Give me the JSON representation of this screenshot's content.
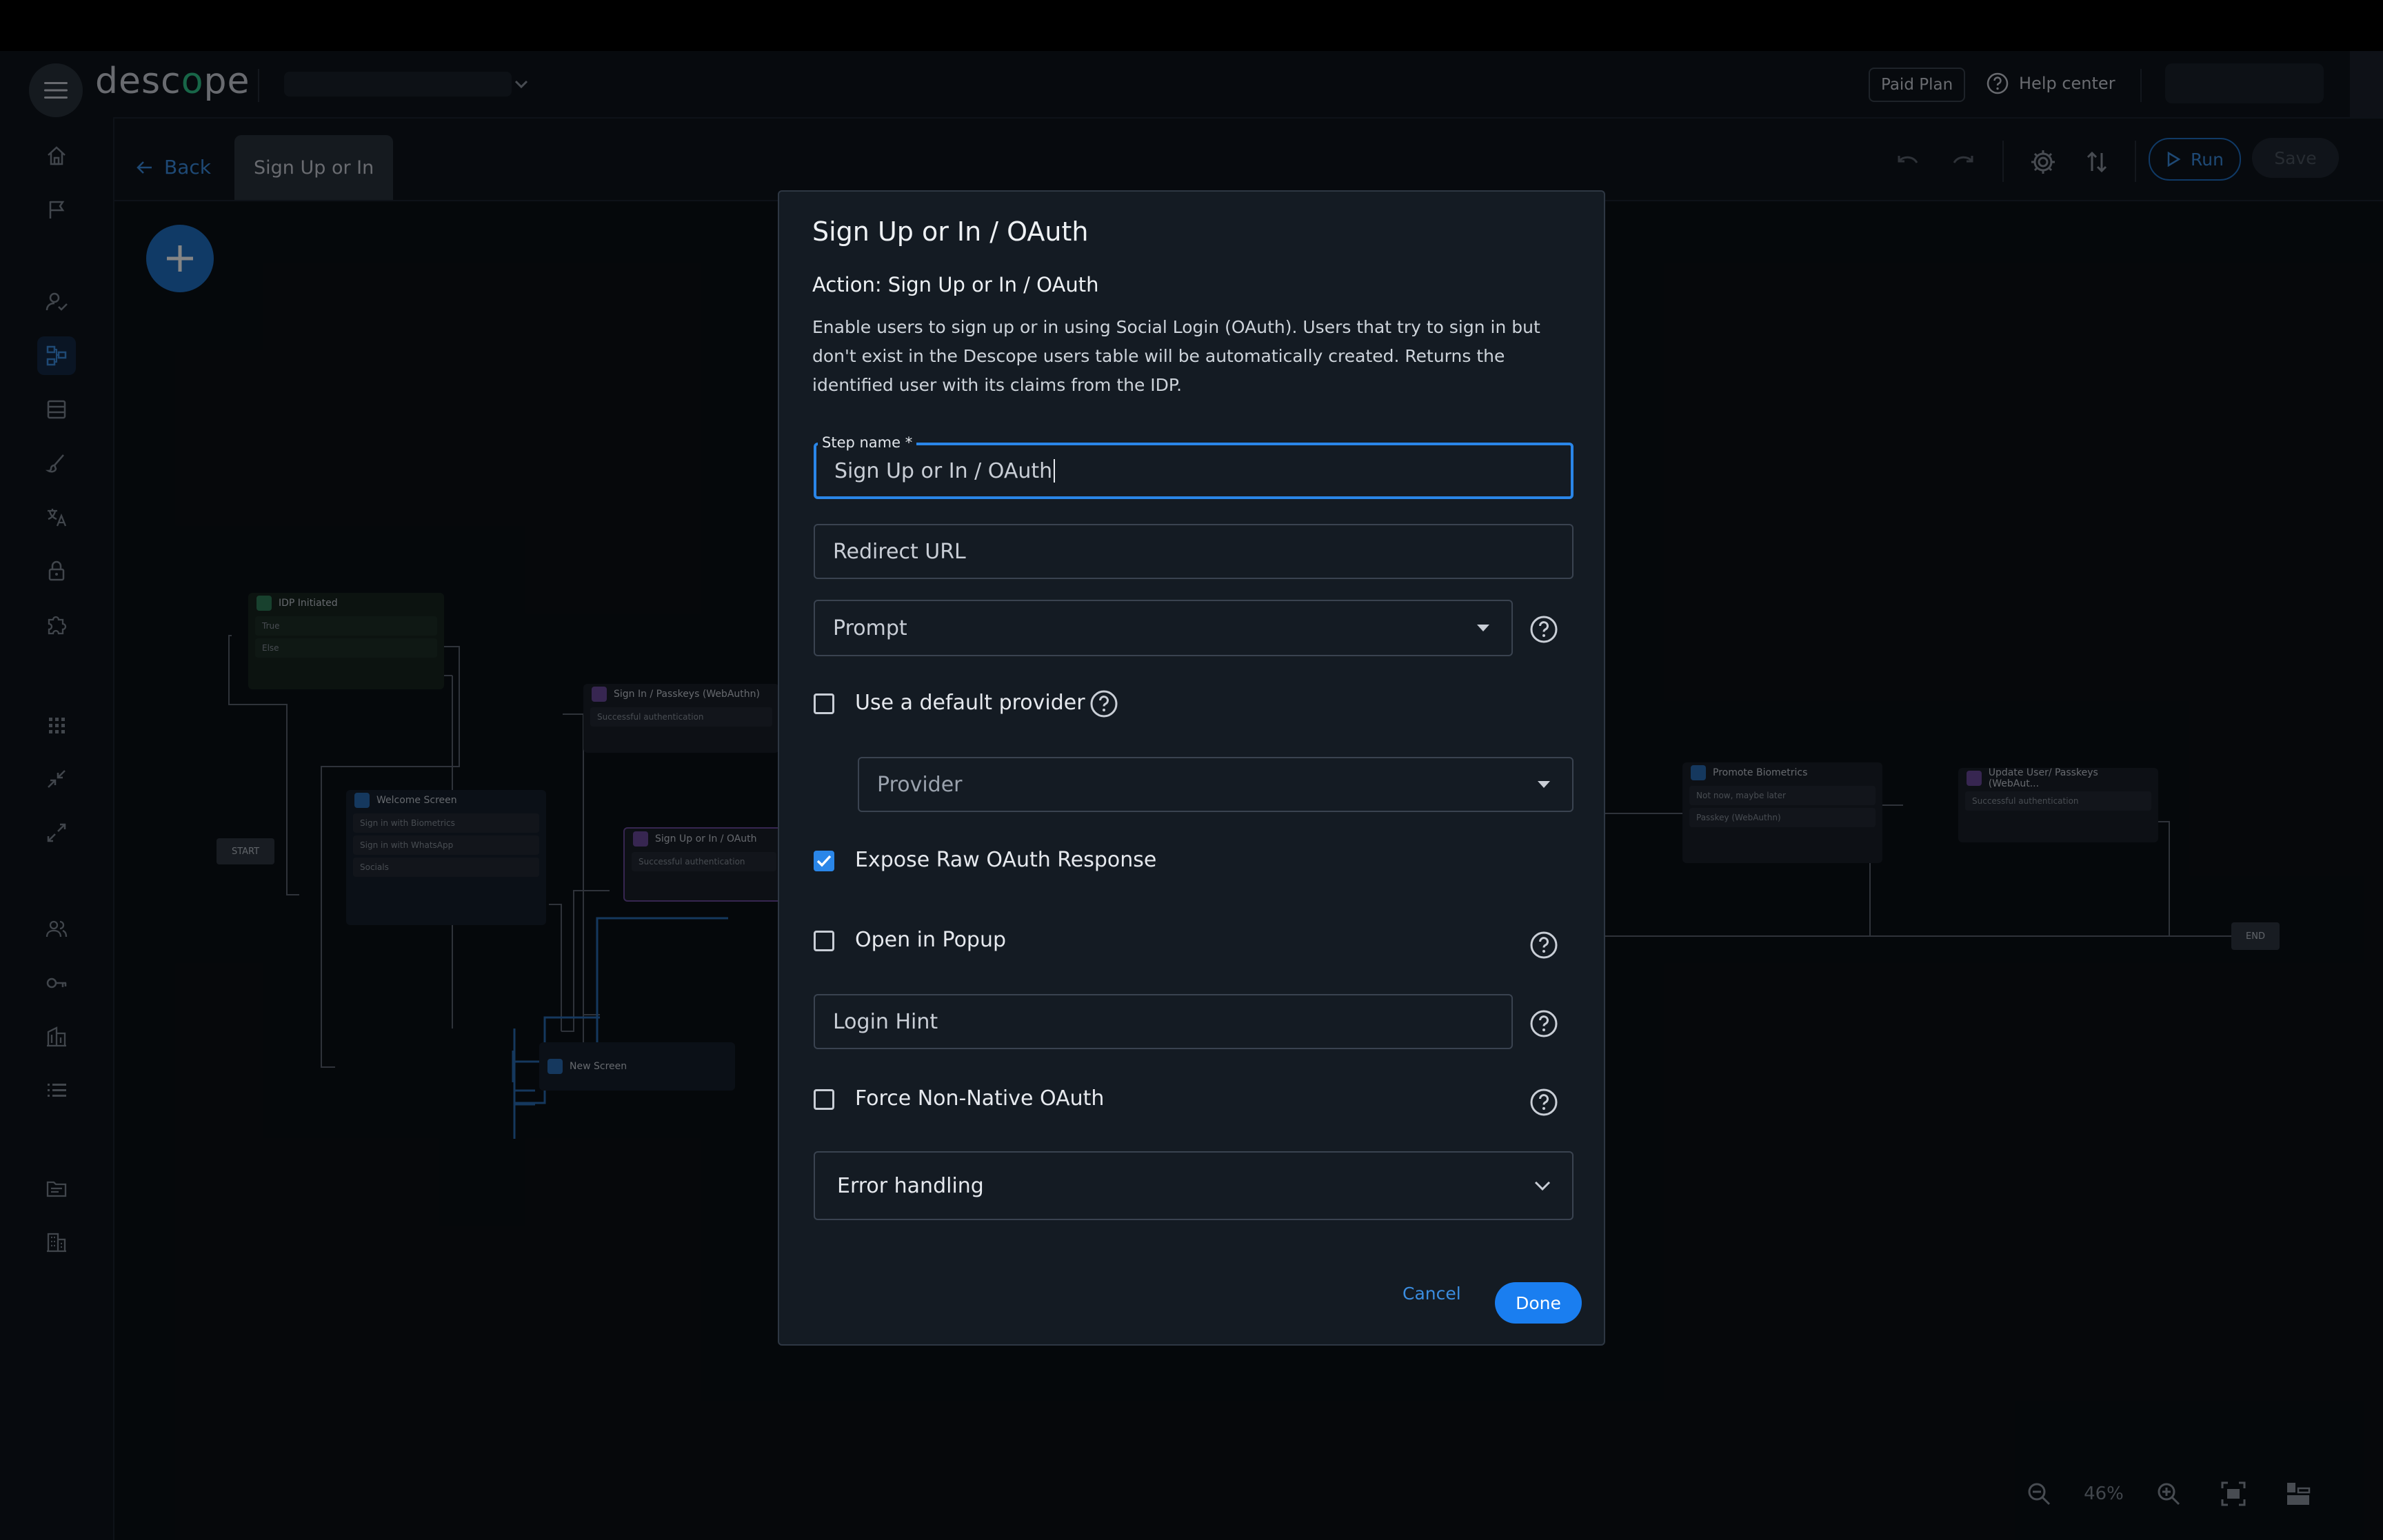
{
  "brand": {
    "logo_text_pre": "desc",
    "logo_text_o": "o",
    "logo_text_post": "pe",
    "accent": "#1a7ef0"
  },
  "topbar": {
    "paid_plan": "Paid Plan",
    "help_center": "Help center"
  },
  "subbar": {
    "back": "Back",
    "tab": "Sign Up or In",
    "run": "Run",
    "save": "Save"
  },
  "canvas": {
    "zoom": "46%",
    "nodes": {
      "idp": {
        "title": "IDP Initiated",
        "rows": [
          "True",
          "Else"
        ]
      },
      "passkeys": {
        "title": "Sign In / Passkeys (WebAuthn)",
        "rows": [
          "Successful authentication"
        ]
      },
      "welcome": {
        "title": "Welcome Screen",
        "rows": [
          "Sign in with Biometrics",
          "Sign in with WhatsApp",
          "Socials"
        ]
      },
      "oauth": {
        "title": "Sign Up or In / OAuth",
        "rows": [
          "Successful authentication"
        ]
      },
      "newscreen": {
        "title": "New Screen"
      },
      "promote": {
        "title": "Promote Biometrics",
        "rows": [
          "Not now, maybe later",
          "Passkey (WebAuthn)"
        ]
      },
      "update": {
        "title": "Update User/ Passkeys (WebAut...",
        "rows": [
          "Successful authentication"
        ]
      },
      "start": "START",
      "end": "END"
    }
  },
  "modal": {
    "title": "Sign Up or In / OAuth",
    "action": "Action: Sign Up or In / OAuth",
    "description": "Enable users to sign up or in using Social Login (OAuth). Users that try to sign in but don't exist in the Descope users table will be automatically created. Returns the identified user with its claims from the IDP.",
    "step_name_label": "Step name *",
    "step_name_value": "Sign Up or In / OAuth",
    "redirect_url_placeholder": "Redirect URL",
    "prompt_placeholder": "Prompt",
    "use_default_provider": "Use a default provider",
    "provider_placeholder": "Provider",
    "expose_raw": "Expose Raw OAuth Response",
    "open_popup": "Open in Popup",
    "login_hint_placeholder": "Login Hint",
    "force_non_native": "Force Non-Native OAuth",
    "error_handling": "Error handling",
    "cancel": "Cancel",
    "done": "Done",
    "checkboxes": {
      "use_default_provider": false,
      "expose_raw": true,
      "open_popup": false,
      "force_non_native": false
    }
  }
}
